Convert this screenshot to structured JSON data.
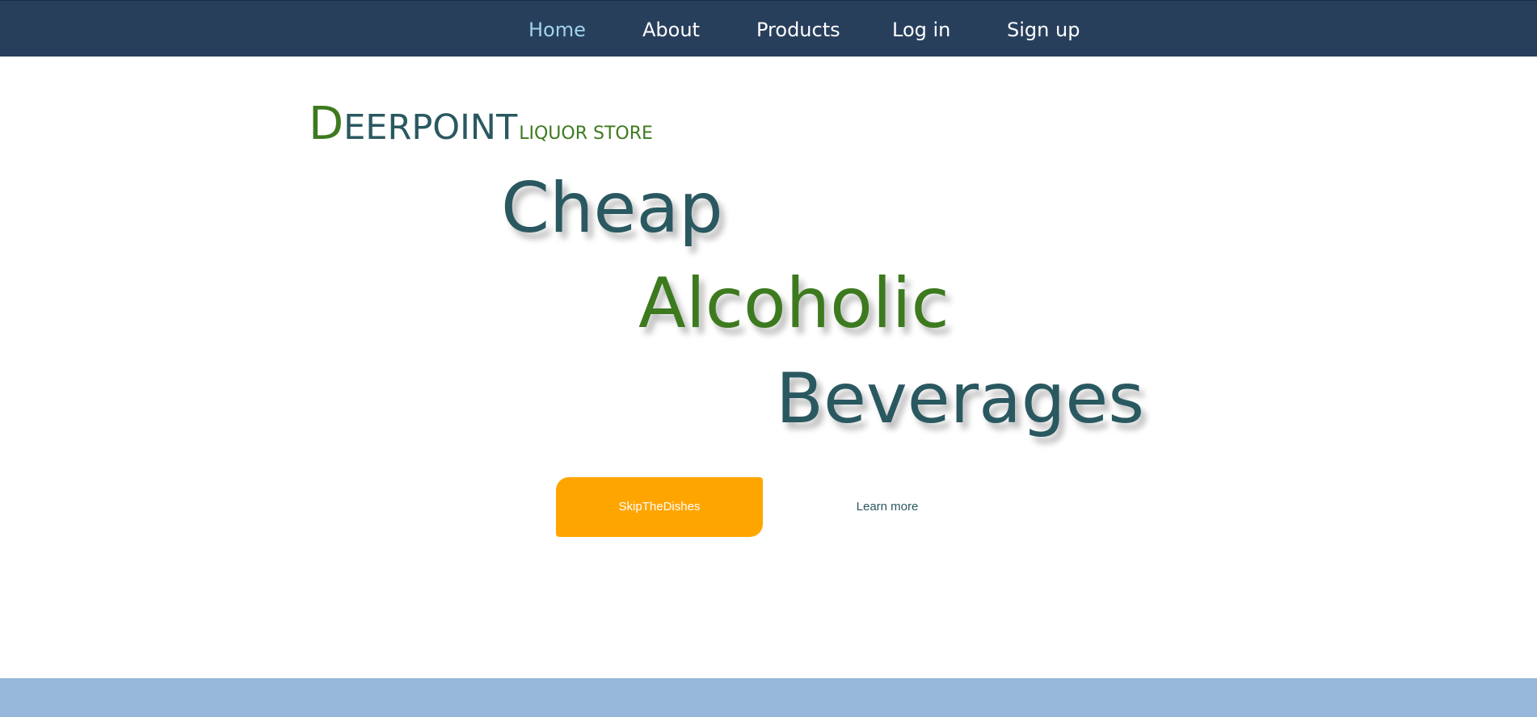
{
  "nav": {
    "items": [
      {
        "label": "Home",
        "active": true
      },
      {
        "label": "About",
        "active": false
      },
      {
        "label": "Products",
        "active": false
      },
      {
        "label": "Log in",
        "active": false
      },
      {
        "label": "Sign up",
        "active": false
      }
    ]
  },
  "brand": {
    "first_letter": "D",
    "rest": "EERPOINT",
    "subtitle": "LIQUOR STORE"
  },
  "hero": {
    "words": [
      "Cheap",
      "Alcoholic",
      "Beverages"
    ]
  },
  "cta": {
    "primary_label": "SkipTheDishes",
    "secondary_label": "Learn more"
  },
  "colors": {
    "nav_background": "#283f5c",
    "nav_active": "#9fd4ec",
    "teal_text": "#2a5860",
    "green_text": "#3d7a1f",
    "button_orange": "#ffa500",
    "footer_band": "#96b7d9"
  }
}
